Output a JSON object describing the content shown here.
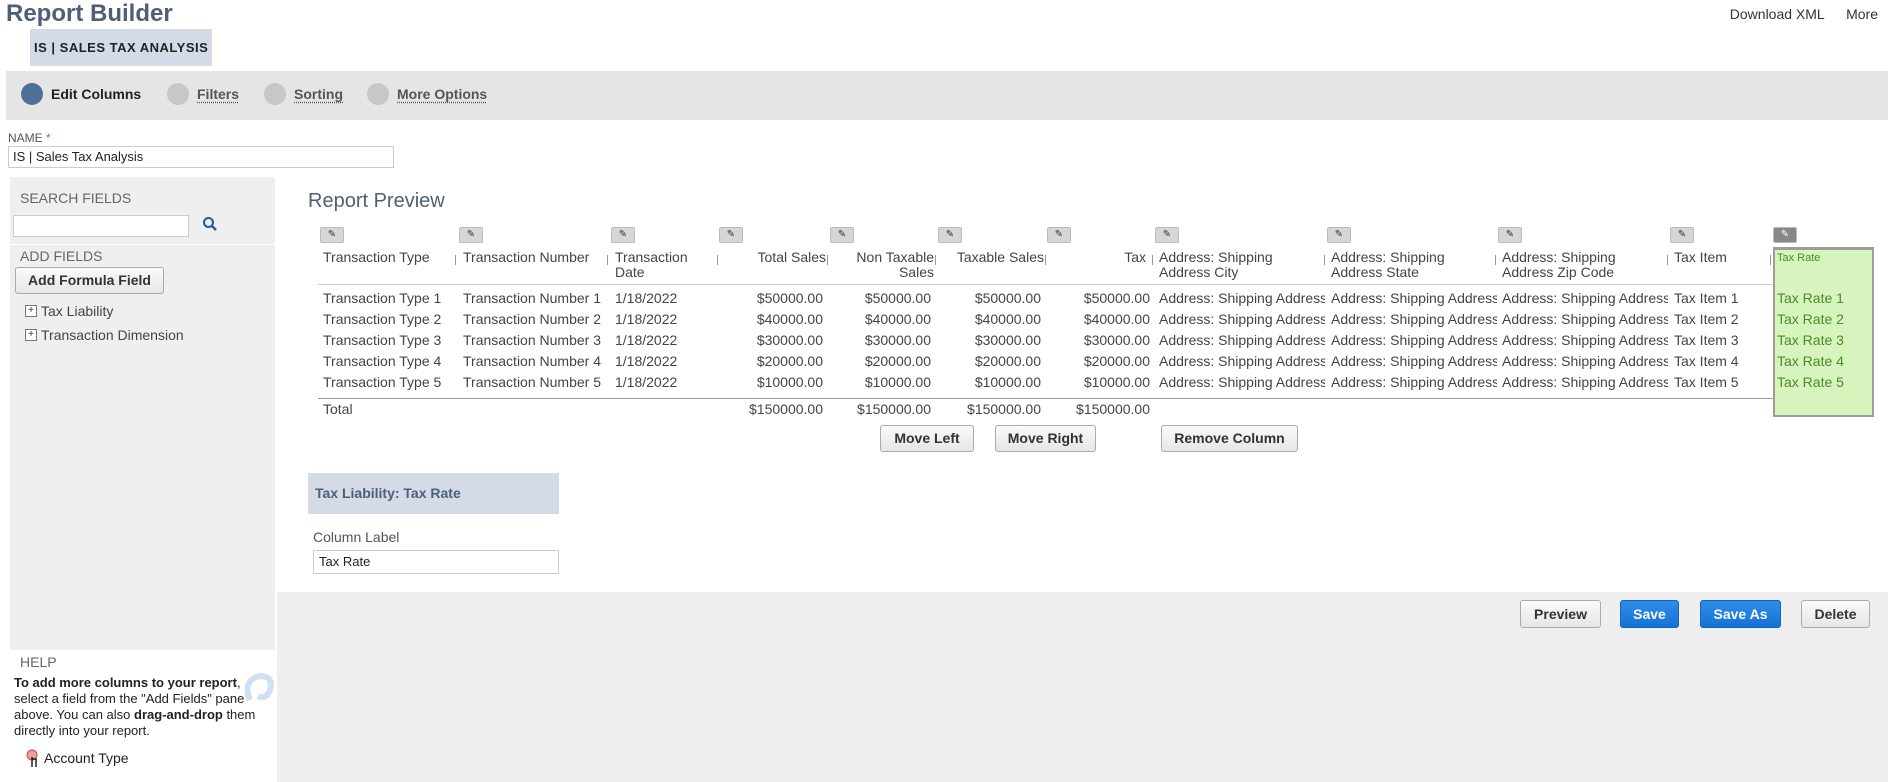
{
  "app": {
    "title": "Report Builder",
    "report_badge": "IS | SALES TAX ANALYSIS"
  },
  "top_links": {
    "download_xml": "Download XML",
    "more": "More"
  },
  "steps": [
    {
      "label": "Edit Columns",
      "active": true
    },
    {
      "label": "Filters",
      "active": false
    },
    {
      "label": "Sorting",
      "active": false
    },
    {
      "label": "More Options",
      "active": false
    }
  ],
  "name_field": {
    "label": "NAME",
    "required_mark": "*",
    "value": "IS | Sales Tax Analysis"
  },
  "left_panel": {
    "search_heading": "SEARCH FIELDS",
    "search_value": "",
    "add_fields_heading": "ADD FIELDS",
    "add_formula_button": "Add Formula Field",
    "tree": [
      "Tax Liability",
      "Transaction Dimension"
    ],
    "help": {
      "heading": "HELP",
      "bold1": "To add more columns to your report",
      "text1": ", select a field from the \"Add Fields\" pane above. You can also ",
      "bold2": "drag-and-drop",
      "text2": " them directly into your report.",
      "drag_item": "Account Type"
    }
  },
  "preview": {
    "title": "Report Preview",
    "columns": [
      "Transaction Type",
      "Transaction Number",
      "Transaction Date",
      "Total Sales",
      "Non Taxable Sales",
      "Taxable Sales",
      "Tax",
      "Address: Shipping Address City",
      "Address: Shipping Address State",
      "Address: Shipping Address Zip Code",
      "Tax Item",
      "Tax Rate"
    ],
    "rows": [
      [
        "Transaction Type 1",
        "Transaction Number 1",
        "1/18/2022",
        "$50000.00",
        "$50000.00",
        "$50000.00",
        "$50000.00",
        "Address: Shipping Address",
        "Address: Shipping Address",
        "Address: Shipping Address",
        "Tax Item 1",
        "Tax Rate 1"
      ],
      [
        "Transaction Type 2",
        "Transaction Number 2",
        "1/18/2022",
        "$40000.00",
        "$40000.00",
        "$40000.00",
        "$40000.00",
        "Address: Shipping Address",
        "Address: Shipping Address",
        "Address: Shipping Address",
        "Tax Item 2",
        "Tax Rate 2"
      ],
      [
        "Transaction Type 3",
        "Transaction Number 3",
        "1/18/2022",
        "$30000.00",
        "$30000.00",
        "$30000.00",
        "$30000.00",
        "Address: Shipping Address",
        "Address: Shipping Address",
        "Address: Shipping Address",
        "Tax Item 3",
        "Tax Rate 3"
      ],
      [
        "Transaction Type 4",
        "Transaction Number 4",
        "1/18/2022",
        "$20000.00",
        "$20000.00",
        "$20000.00",
        "$20000.00",
        "Address: Shipping Address",
        "Address: Shipping Address",
        "Address: Shipping Address",
        "Tax Item 4",
        "Tax Rate 4"
      ],
      [
        "Transaction Type 5",
        "Transaction Number 5",
        "1/18/2022",
        "$10000.00",
        "$10000.00",
        "$10000.00",
        "$10000.00",
        "Address: Shipping Address",
        "Address: Shipping Address",
        "Address: Shipping Address",
        "Tax Item 5",
        "Tax Rate 5"
      ]
    ],
    "total": {
      "label": "Total",
      "total_sales": "$150000.00",
      "non_taxable": "$150000.00",
      "taxable": "$150000.00",
      "tax": "$150000.00"
    },
    "buttons": {
      "move_left": "Move Left",
      "move_right": "Move Right",
      "remove_column": "Remove Column"
    }
  },
  "column_detail": {
    "heading": "Tax Liability: Tax Rate",
    "label_caption": "Column Label",
    "label_value": "Tax Rate"
  },
  "footer_buttons": {
    "preview": "Preview",
    "save": "Save",
    "save_as": "Save As",
    "delete": "Delete"
  },
  "colors": {
    "title": "#4d5f79",
    "accent_blue": "#1673d4",
    "highlight_green": "#d7f4bf"
  }
}
